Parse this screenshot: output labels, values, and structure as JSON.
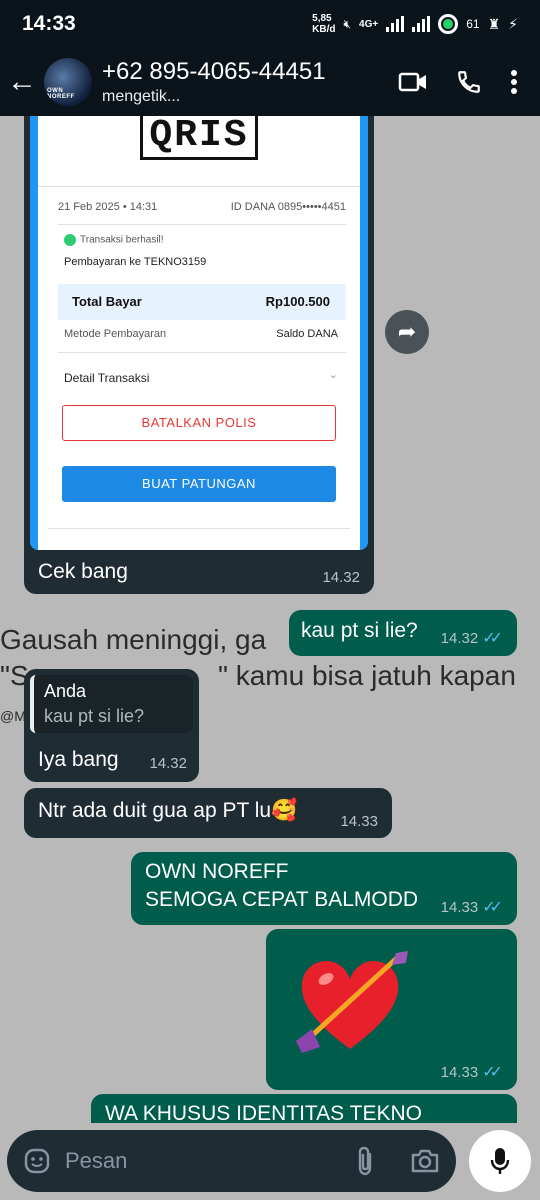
{
  "status_bar": {
    "time": "14:33",
    "speed_value": "5,85",
    "speed_unit": "KB/d",
    "network": "4G+",
    "battery": "61"
  },
  "header": {
    "contact": "+62 895-4065-44451",
    "status": "mengetik...",
    "avatar_text": "OWN NOREFF"
  },
  "receipt": {
    "logo": "QRIS",
    "date": "21 Feb 2025 • 14:31",
    "dana_id": "ID DANA 0895•••••4451",
    "success": "Transaksi berhasil!",
    "payee": "Pembayaran ke TEKNO3159",
    "total_label": "Total Bayar",
    "total_value": "Rp100.500",
    "method_label": "Metode Pembayaran",
    "method_value": "Saldo DANA",
    "detail_label": "Detail Transaksi",
    "cancel_button": "BATALKAN POLIS",
    "split_button": "BUAT PATUNGAN"
  },
  "messages": [
    {
      "dir": "in",
      "text": "Cek bang",
      "time": "14.32"
    },
    {
      "dir": "out",
      "text": "kau pt si lie?",
      "time": "14.32"
    },
    {
      "dir": "in",
      "quote_author": "Anda",
      "quote_text": "kau pt si lie?",
      "text": "Iya bang",
      "time": "14.32"
    },
    {
      "dir": "in",
      "text": "Ntr ada duit gua ap PT lu🥰",
      "time": "14.33"
    },
    {
      "dir": "out",
      "line1": "OWN NOREFF",
      "line2": "SEMOGA CEPAT BALMODD",
      "time": "14.33"
    },
    {
      "dir": "out",
      "sticker": "heart-with-arrow",
      "time": "14.33"
    },
    {
      "dir": "out",
      "text": "WA KHUSUS IDENTITAS TEKNO"
    }
  ],
  "background_text": {
    "line1": "Gausah meninggi, ga",
    "line2a": "\"S",
    "line2b": "\" kamu bisa jatuh kapan",
    "line3": "@M"
  },
  "input": {
    "placeholder": "Pesan"
  },
  "icons": [
    "back-arrow-icon",
    "video-call-icon",
    "phone-icon",
    "more-vert-icon",
    "forward-icon",
    "emoji-icon",
    "attach-icon",
    "camera-icon",
    "mic-icon"
  ],
  "colors": {
    "incoming": "#202c33",
    "outgoing": "#005c4b",
    "read_ticks": "#53bdeb",
    "dana_blue": "#2196f3"
  }
}
